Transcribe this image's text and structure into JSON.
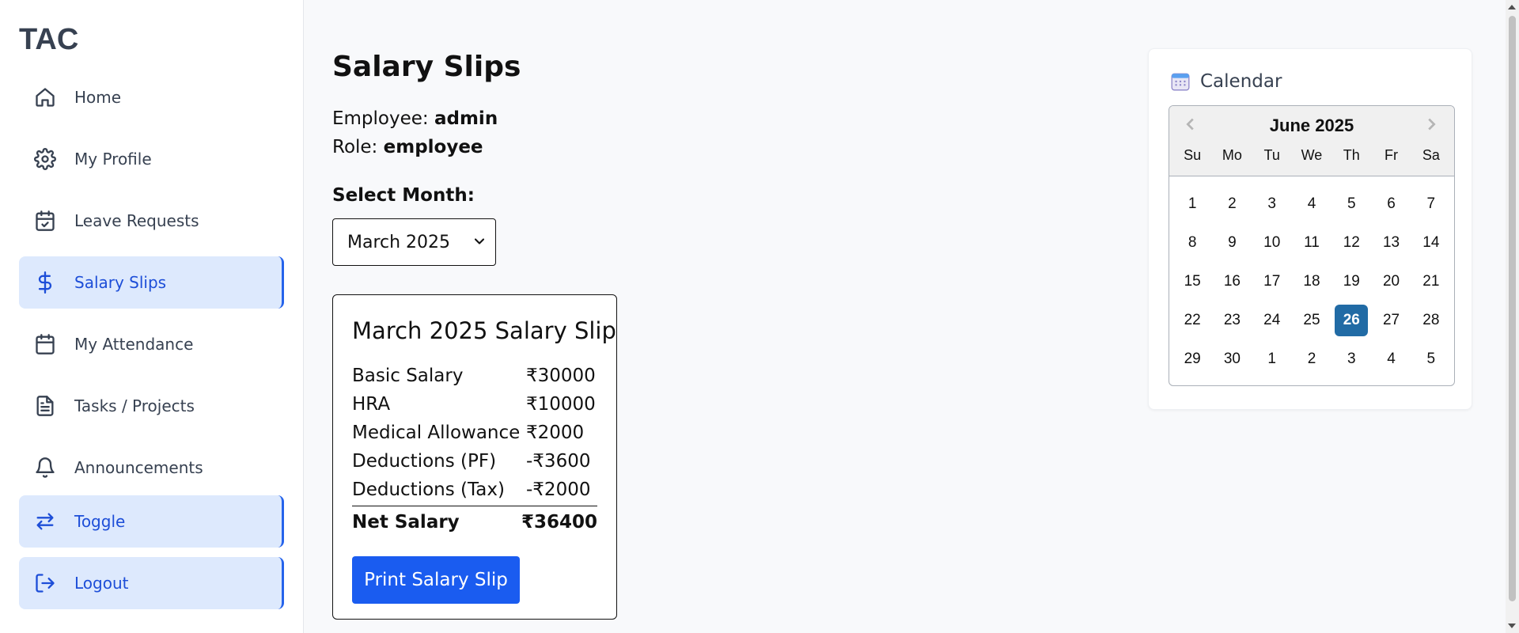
{
  "brand": "TAC",
  "sidebar": {
    "items": [
      {
        "label": "Home",
        "icon": "home-icon"
      },
      {
        "label": "My Profile",
        "icon": "gear-icon"
      },
      {
        "label": "Leave Requests",
        "icon": "calendar-check-icon"
      },
      {
        "label": "Salary Slips",
        "icon": "dollar-icon",
        "active": true
      },
      {
        "label": "My Attendance",
        "icon": "calendar-icon"
      },
      {
        "label": "Tasks / Projects",
        "icon": "document-icon"
      },
      {
        "label": "Announcements",
        "icon": "bell-icon"
      }
    ],
    "toggle_label": "Toggle",
    "logout_label": "Logout"
  },
  "main": {
    "title": "Salary Slips",
    "employee_label": "Employee:",
    "employee_value": "admin",
    "role_label": "Role:",
    "role_value": "employee",
    "select_label": "Select Month:",
    "selected_month": "March 2025",
    "slip": {
      "title": "March 2025 Salary Slip",
      "rows": [
        {
          "label": "Basic Salary",
          "value": "₹30000"
        },
        {
          "label": "HRA",
          "value": "₹10000"
        },
        {
          "label": "Medical Allowance",
          "value": "₹2000"
        },
        {
          "label": "Deductions (PF)",
          "value": "-₹3600"
        },
        {
          "label": "Deductions (Tax)",
          "value": "-₹2000"
        }
      ],
      "net_label": "Net Salary",
      "net_value": "₹36400",
      "print_label": "Print Salary Slip"
    }
  },
  "calendar": {
    "header": "Calendar",
    "month": "June 2025",
    "weekdays": [
      "Su",
      "Mo",
      "Tu",
      "We",
      "Th",
      "Fr",
      "Sa"
    ],
    "weeks": [
      [
        "1",
        "2",
        "3",
        "4",
        "5",
        "6",
        "7"
      ],
      [
        "8",
        "9",
        "10",
        "11",
        "12",
        "13",
        "14"
      ],
      [
        "15",
        "16",
        "17",
        "18",
        "19",
        "20",
        "21"
      ],
      [
        "22",
        "23",
        "24",
        "25",
        "26",
        "27",
        "28"
      ],
      [
        "29",
        "30",
        "1",
        "2",
        "3",
        "4",
        "5"
      ]
    ],
    "today": "26",
    "today_color": "#216ba5"
  },
  "colors": {
    "accent": "#1a5cf0",
    "active_bg": "#dde9fd"
  }
}
